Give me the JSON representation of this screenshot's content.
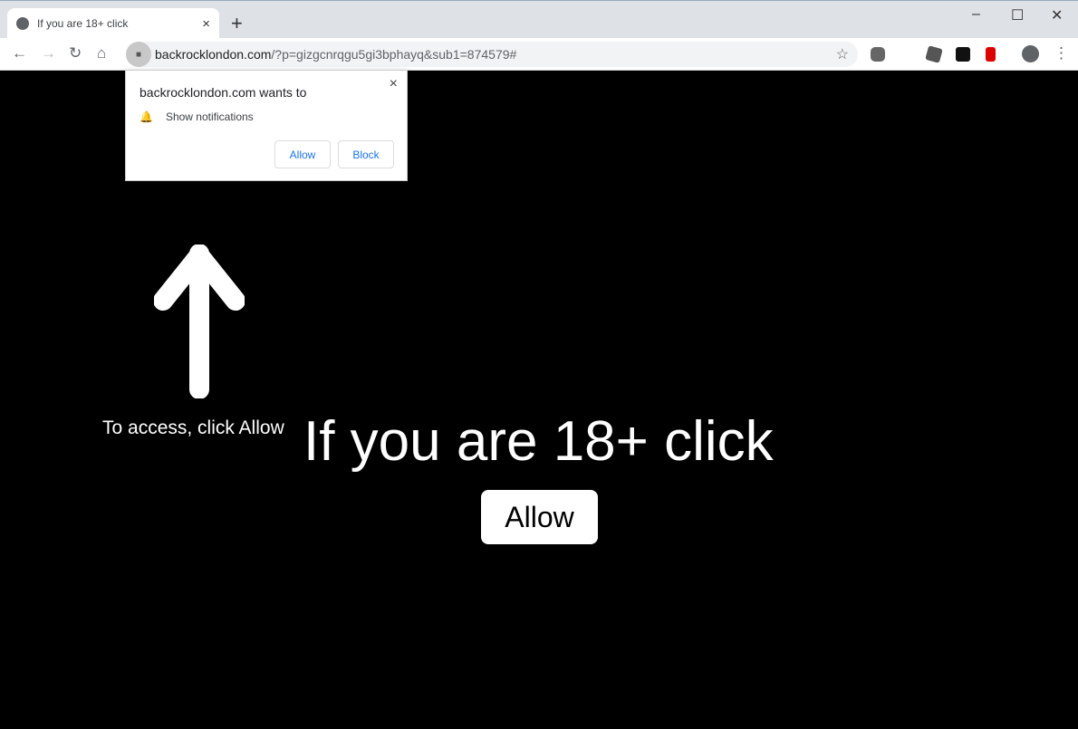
{
  "tab": {
    "title": "If you are 18+ click",
    "close": "×",
    "new": "+"
  },
  "window": {
    "min": "–",
    "max": "☐",
    "close": "✕"
  },
  "toolbar": {
    "back": "←",
    "forward": "→",
    "reload": "↻",
    "home": "⌂",
    "url_host": "backrocklondon.com",
    "url_path": "/?p=gizgcnrqgu5gi3bphayq&sub1=874579#",
    "star": "☆",
    "menu": "⋮"
  },
  "popup": {
    "title": "backrocklondon.com wants to",
    "permission": "Show notifications",
    "allow": "Allow",
    "block": "Block",
    "close": "×"
  },
  "page": {
    "hint": "To access, click Allow",
    "headline": "If you are 18+ click",
    "button": "Allow"
  }
}
